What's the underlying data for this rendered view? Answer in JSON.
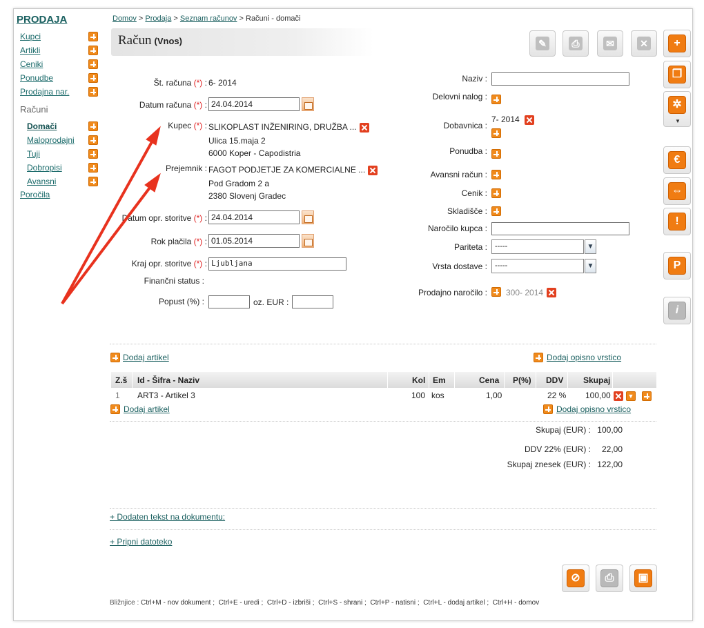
{
  "breadcrumb": {
    "home": "Domov",
    "sales": "Prodaja",
    "list": "Seznam računov",
    "current": "Računi - domači",
    "sep": ">"
  },
  "sidebar": {
    "title": "PRODAJA",
    "items": [
      {
        "label": "Kupci"
      },
      {
        "label": "Artikli"
      },
      {
        "label": "Ceniki"
      },
      {
        "label": "Ponudbe"
      },
      {
        "label": "Prodajna nar."
      }
    ],
    "section": "Računi",
    "subitems": [
      {
        "label": "Domači"
      },
      {
        "label": "Maloprodajni"
      },
      {
        "label": "Tuji"
      },
      {
        "label": "Dobropisi"
      },
      {
        "label": "Avansni"
      }
    ],
    "reports": "Poročila"
  },
  "header": {
    "title": "Račun",
    "subtitle": "(Vnos)"
  },
  "form": {
    "invoice_no_label": "Št. računa",
    "invoice_no": "6- 2014",
    "invoice_date_label": "Datum računa",
    "invoice_date": "24.04.2014",
    "buyer_label": "Kupec",
    "buyer_name": "SLIKOPLAST INŽENIRING, DRUŽBA ...",
    "buyer_street": "Ulica 15.maja 2",
    "buyer_city": "6000 Koper - Capodistria",
    "recipient_label": "Prejemnik :",
    "recipient_name": "FAGOT PODJETJE ZA KOMERCIALNE ...",
    "recipient_street": "Pod Gradom 2 a",
    "recipient_city": "2380 Slovenj Gradec",
    "service_date_label": "Datum opr. storitve",
    "service_date": "24.04.2014",
    "due_label": "Rok plačila",
    "due_date": "01.05.2014",
    "place_label": "Kraj opr. storitve",
    "place": "Ljubljana",
    "fin_status_label": "Finančni status :",
    "discount_label": "Popust (%) :",
    "discount_eur_label": "oz. EUR :",
    "req_mark": "(*)",
    "colon": ":"
  },
  "right_form": {
    "name_label": "Naziv :",
    "work_order_label": "Delovni nalog :",
    "delivery_note_label": "Dobavnica :",
    "delivery_note": "7- 2014",
    "offer_label": "Ponudba :",
    "advance_label": "Avansni račun :",
    "pricelist_label": "Cenik :",
    "warehouse_label": "Skladišče :",
    "order_label": "Naročilo kupca :",
    "parity_label": "Pariteta :",
    "parity_value": "-----",
    "delivery_type_label": "Vrsta dostave :",
    "delivery_type_value": "-----",
    "sales_order_label": "Prodajno naročilo :",
    "sales_order": "300- 2014"
  },
  "links": {
    "add_article": "Dodaj artikel",
    "add_desc": "Dodaj opisno vrstico",
    "extra_text": "+ Dodaten tekst na dokumentu:",
    "attach": "+ Pripni datoteko"
  },
  "table": {
    "headers": [
      "Z.š",
      "Id - Šifra - Naziv",
      "Kol",
      "Em",
      "Cena",
      "P(%)",
      "DDV",
      "Skupaj"
    ],
    "rows": [
      {
        "no": "1",
        "name": "ART3 - Artikel 3",
        "qty": "100",
        "unit": "kos",
        "price": "1,00",
        "disc": "",
        "vat": "22 %",
        "total": "100,00"
      }
    ]
  },
  "totals": {
    "sum_label": "Skupaj (EUR) :",
    "sum": "100,00",
    "vat_label": "DDV 22% (EUR) :",
    "vat": "22,00",
    "grand_label": "Skupaj znesek (EUR) :",
    "grand": "122,00"
  },
  "shortcuts": {
    "label": "Bližnjice :",
    "items": [
      "Ctrl+M - nov dokument ;",
      "Ctrl+E - uredi ;",
      "Ctrl+D - izbriši ;",
      "Ctrl+S - shrani ;",
      "Ctrl+P - natisni ;",
      "Ctrl+L - dodaj artikel ;",
      "Ctrl+H - domov"
    ]
  },
  "colors": {
    "accent_orange": "#f08a1c",
    "link_teal": "#1a5f5f",
    "required_red": "#e02020",
    "arrow_red": "#e8321e"
  }
}
